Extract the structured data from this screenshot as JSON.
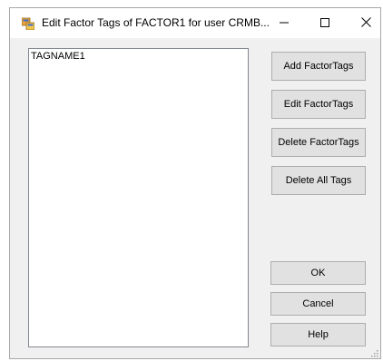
{
  "window": {
    "title": "Edit Factor Tags of FACTOR1 for user CRMB...",
    "icon": "dialog-window-icon",
    "controls": {
      "minimize_icon": "minimize-icon",
      "maximize_icon": "maximize-icon",
      "close_icon": "close-icon"
    }
  },
  "tag_list": {
    "items": [
      "TAGNAME1"
    ]
  },
  "buttons": {
    "add_label": "Add FactorTags",
    "edit_label": "Edit FactorTags",
    "delete_label": "Delete FactorTags",
    "delete_all_label": "Delete All Tags",
    "ok_label": "OK",
    "cancel_label": "Cancel",
    "help_label": "Help"
  },
  "colors": {
    "window_bg": "#f0f0f0",
    "button_bg": "#e1e1e1",
    "button_border": "#adadad",
    "list_border": "#828790"
  }
}
